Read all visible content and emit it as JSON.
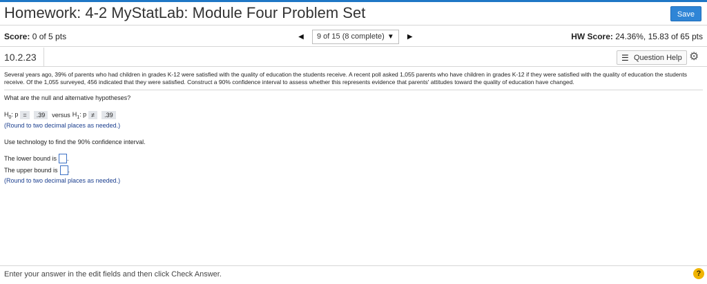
{
  "header": {
    "title": "Homework: 4-2 MyStatLab: Module Four Problem Set",
    "save_label": "Save"
  },
  "scorebar": {
    "score_label": "Score:",
    "score_value": "0 of 5 pts",
    "nav_text": "9 of 15 (8 complete)",
    "hw_score_label": "HW Score:",
    "hw_score_value": "24.36%, 15.83 of 65 pts"
  },
  "question": {
    "number": "10.2.23",
    "help_label": "Question Help"
  },
  "problem": {
    "text": "Several years ago, 39% of parents who had children in grades K-12 were satisfied with the quality of education the students receive. A recent poll asked 1,055 parents who have children in grades K-12 if they were satisfied with the quality of education the students receive. Of the 1,055 surveyed, 456 indicated that they were satisfied. Construct a 90% confidence interval to assess whether this represents evidence that parents' attitudes toward the quality of education have changed.",
    "prompt": "What are the null and alternative hypotheses?",
    "h0_label": "H",
    "h0_sub": "0",
    "h0_var": ": p",
    "h0_op": "=",
    "h0_val": ".39",
    "versus": "versus",
    "h1_label": "H",
    "h1_sub": "1",
    "h1_var": ": p",
    "h1_op": "≠",
    "h1_val": ".39",
    "round_hint_1": "(Round to two decimal places as needed.)",
    "tech_prompt": "Use technology to find the 90% confidence interval.",
    "lower_label": "The lower bound is",
    "upper_label": "The upper bound is",
    "round_hint_2": "(Round to two decimal places as needed.)"
  },
  "footer": {
    "text": "Enter your answer in the edit fields and then click Check Answer.",
    "help_symbol": "?"
  },
  "colors": {
    "accent": "#2f85d6",
    "hint_text": "#1b3f8f",
    "help_icon": "#f0b400"
  }
}
